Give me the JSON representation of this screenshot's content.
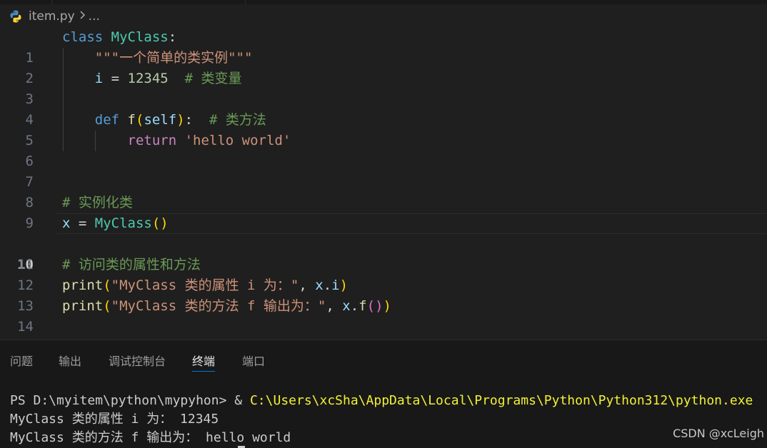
{
  "breadcrumb": {
    "file": "item.py",
    "ellipsis": "..."
  },
  "lines": [
    {
      "n": "1"
    },
    {
      "n": "2"
    },
    {
      "n": "3"
    },
    {
      "n": "4"
    },
    {
      "n": "5"
    },
    {
      "n": "6"
    },
    {
      "n": "7"
    },
    {
      "n": "8"
    },
    {
      "n": "9"
    },
    {
      "n": "10"
    },
    {
      "n": "11"
    },
    {
      "n": "12"
    },
    {
      "n": "13"
    },
    {
      "n": "14"
    }
  ],
  "code": {
    "l1": {
      "kw": "class",
      "name": "MyClass",
      "colon": ":"
    },
    "l2": {
      "doc": "\"\"\"一个简单的类实例\"\"\""
    },
    "l3": {
      "var": "i",
      "eq": " = ",
      "num": "12345",
      "cmt": "  # 类变量"
    },
    "l5": {
      "kw": "def",
      "fn": "f",
      "p1": "(",
      "self": "self",
      "p2": ")",
      "colon": ":",
      "cmt": "  # 类方法"
    },
    "l6": {
      "kw": "return",
      "str": "'hello world'"
    },
    "l9": {
      "cmt": "# 实例化类"
    },
    "l10": {
      "var": "x",
      "eq": " = ",
      "cls": "MyClass",
      "p": "()"
    },
    "l12": {
      "cmt": "# 访问类的属性和方法"
    },
    "l13": {
      "fn": "print",
      "p1": "(",
      "str": "\"MyClass 类的属性 i 为：\"",
      "comma": ", ",
      "obj": "x",
      "dot": ".",
      "attr": "i",
      "p2": ")"
    },
    "l14": {
      "fn": "print",
      "p1": "(",
      "str": "\"MyClass 类的方法 f 输出为：\"",
      "comma": ", ",
      "obj": "x",
      "dot": ".",
      "fn2": "f",
      "p3": "()",
      "p2": ")"
    }
  },
  "panel": {
    "tabs": [
      "问题",
      "输出",
      "调试控制台",
      "终端",
      "端口"
    ],
    "active_tab": "终端"
  },
  "terminal": {
    "prompt": "PS D:\\myitem\\python\\mypyhon> ",
    "amp": "& ",
    "command": "C:\\Users\\xcSha\\AppData\\Local\\Programs\\Python\\Python312\\python.exe",
    "out1": "MyClass 类的属性 i 为： 12345",
    "out2": "MyClass 类的方法 f 输出为： hello world"
  },
  "watermark": "CSDN @xcLeigh",
  "colors": {
    "accent": "#0078d4",
    "editor_bg": "#1f1f1f",
    "panel_bg": "#181818"
  }
}
